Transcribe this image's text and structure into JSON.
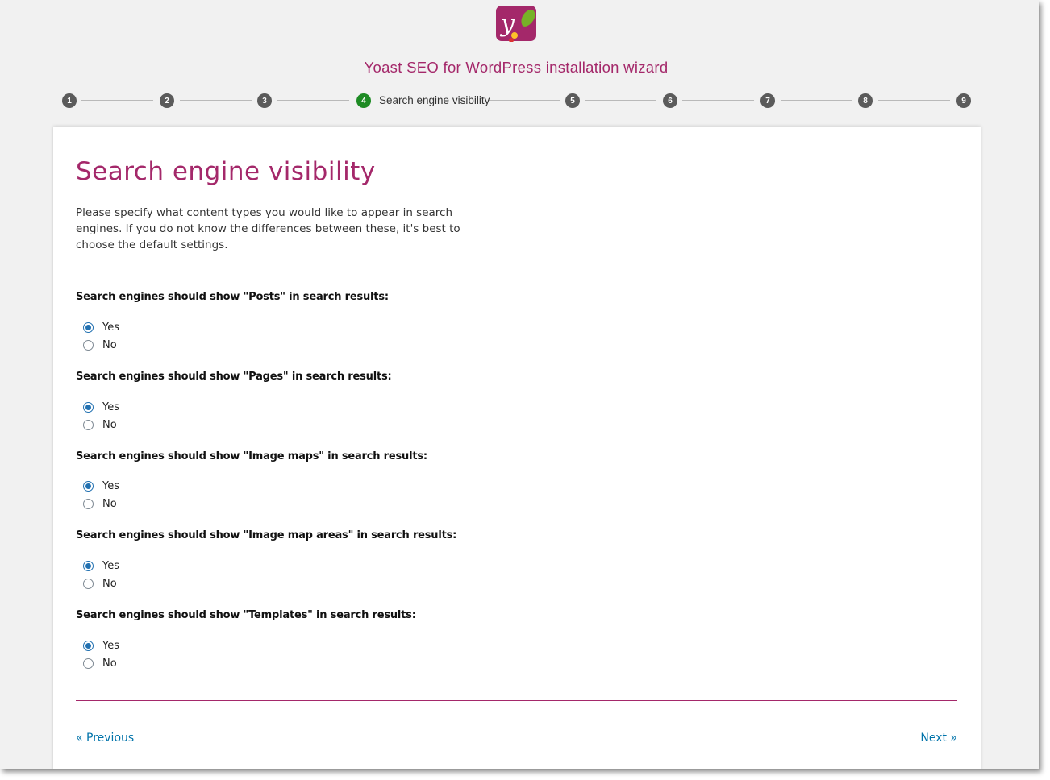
{
  "app": {
    "logo_icon": "yoast-logo-icon",
    "title": "Yoast SEO for WordPress installation wizard",
    "accent_color": "#a4286a"
  },
  "stepper": {
    "active_color": "#1e8b24",
    "steps": [
      {
        "number": "1",
        "label": ""
      },
      {
        "number": "2",
        "label": ""
      },
      {
        "number": "3",
        "label": ""
      },
      {
        "number": "4",
        "label": "Search engine visibility",
        "active": true
      },
      {
        "number": "5",
        "label": ""
      },
      {
        "number": "6",
        "label": ""
      },
      {
        "number": "7",
        "label": ""
      },
      {
        "number": "8",
        "label": ""
      },
      {
        "number": "9",
        "label": ""
      }
    ]
  },
  "main": {
    "title": "Search engine visibility",
    "intro": "Please specify what content types you would like to appear in search engines. If you do not know the differences between these, it's best to choose the default settings.",
    "questions": [
      {
        "label": "Search engines should show \"Posts\" in search results:",
        "options": [
          {
            "label": "Yes",
            "checked": true
          },
          {
            "label": "No",
            "checked": false
          }
        ]
      },
      {
        "label": "Search engines should show \"Pages\" in search results:",
        "options": [
          {
            "label": "Yes",
            "checked": true
          },
          {
            "label": "No",
            "checked": false
          }
        ]
      },
      {
        "label": "Search engines should show \"Image maps\" in search results:",
        "options": [
          {
            "label": "Yes",
            "checked": true
          },
          {
            "label": "No",
            "checked": false
          }
        ]
      },
      {
        "label": "Search engines should show \"Image map areas\" in search results:",
        "options": [
          {
            "label": "Yes",
            "checked": true
          },
          {
            "label": "No",
            "checked": false
          }
        ]
      },
      {
        "label": "Search engines should show \"Templates\" in search results:",
        "options": [
          {
            "label": "Yes",
            "checked": true
          },
          {
            "label": "No",
            "checked": false
          }
        ]
      }
    ]
  },
  "footer": {
    "previous_label": "« Previous",
    "next_label": "Next »"
  }
}
